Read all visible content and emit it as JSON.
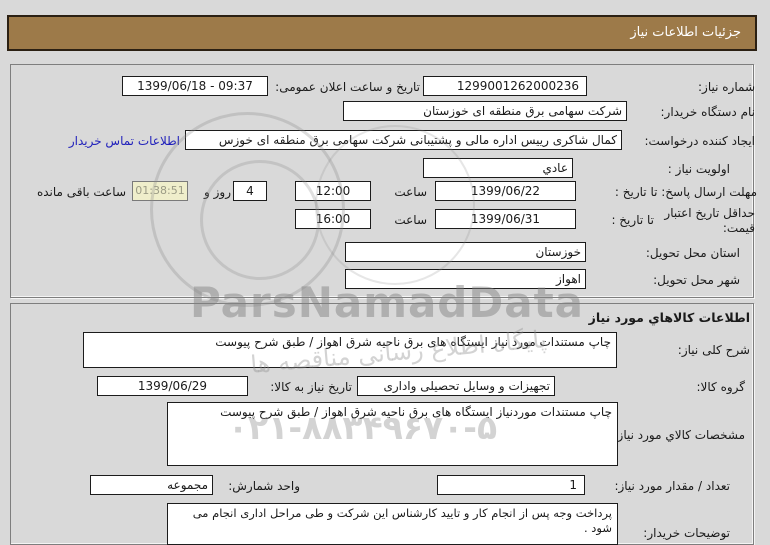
{
  "title_bar": {
    "label": "جزئیات اطلاعات نیاز"
  },
  "colors": {
    "accent_brown": "#9d7a49",
    "countdown_bg": "#efeecb",
    "link_blue": "#2121bb",
    "page_bg": "#d9d9d9"
  },
  "p1": {
    "need_number_label": "شماره نیاز:",
    "need_number_value": "1299001262000236",
    "announce_label": "تاریخ و ساعت اعلان عمومی:",
    "announce_value": "1399/06/18 - 09:37",
    "buyer_label": "نام دستگاه خریدار:",
    "buyer_value": "شرکت سهامی برق منطقه ای خوزستان",
    "creator_label": "ایجاد کننده درخواست:",
    "creator_value": "کمال شاکری رییس اداره مالی و پشتیبانی شرکت سهامی برق منطقه ای خوزس",
    "contact_link": "اطلاعات تماس خریدار",
    "priority_label": "اولویت نیاز :",
    "priority_value": "عادي",
    "deadline_label": "مهلت ارسال پاسخ: تا تاریخ :",
    "deadline_date": "1399/06/22",
    "hour_label": "ساعت",
    "deadline_time": "12:00",
    "days_value": "4",
    "days_label": "روز و",
    "countdown_value": "01:38:51",
    "remaining_label": "ساعت باقی مانده",
    "validity_label": "حداقل تاریخ اعتبار قیمت:",
    "until_label": "تا تاریخ :",
    "validity_date": "1399/06/31",
    "validity_time": "16:00",
    "province_label": "استان محل تحویل:",
    "province_value": "خوزستان",
    "city_label": "شهر محل تحویل:",
    "city_value": "اهواز"
  },
  "p2": {
    "header": "اطلاعات کالاهاي مورد نیاز",
    "desc_label": "شرح کلی نیاز:",
    "desc_value": "چاپ مستندات مورد نیاز ایستگاه های برق ناحیه شرق اهواز / طبق شرح پیوست",
    "group_label": "گروه کالا:",
    "group_value": "تجهیزات و وسایل تحصیلی واداری",
    "need_date_label": "تاریخ نیاز به کالا:",
    "need_date_value": "1399/06/29",
    "specs_label": "مشخصات کالاي مورد نیاز:",
    "specs_value": "چاپ مستندات موردنیاز ایستگاه های برق ناحیه شرق اهواز / طبق شرح پیوست",
    "qty_label": "تعداد / مقدار مورد نیاز:",
    "qty_value": "1",
    "unit_label": "واحد شمارش:",
    "unit_value": "مجموعه",
    "notes_label": "توضیحات خریدار:",
    "notes_value": "پرداخت وجه پس از انجام کار و تایید کارشناس این شرکت و طی مراحل اداری انجام می شود ."
  },
  "watermark": {
    "brand": "ParsNamadData",
    "slogan": "پایگاه اطلاع رسانی مناقصه ها",
    "phone": "۰۲۱-۸۸۳۴۹۶۷۰-۵"
  }
}
